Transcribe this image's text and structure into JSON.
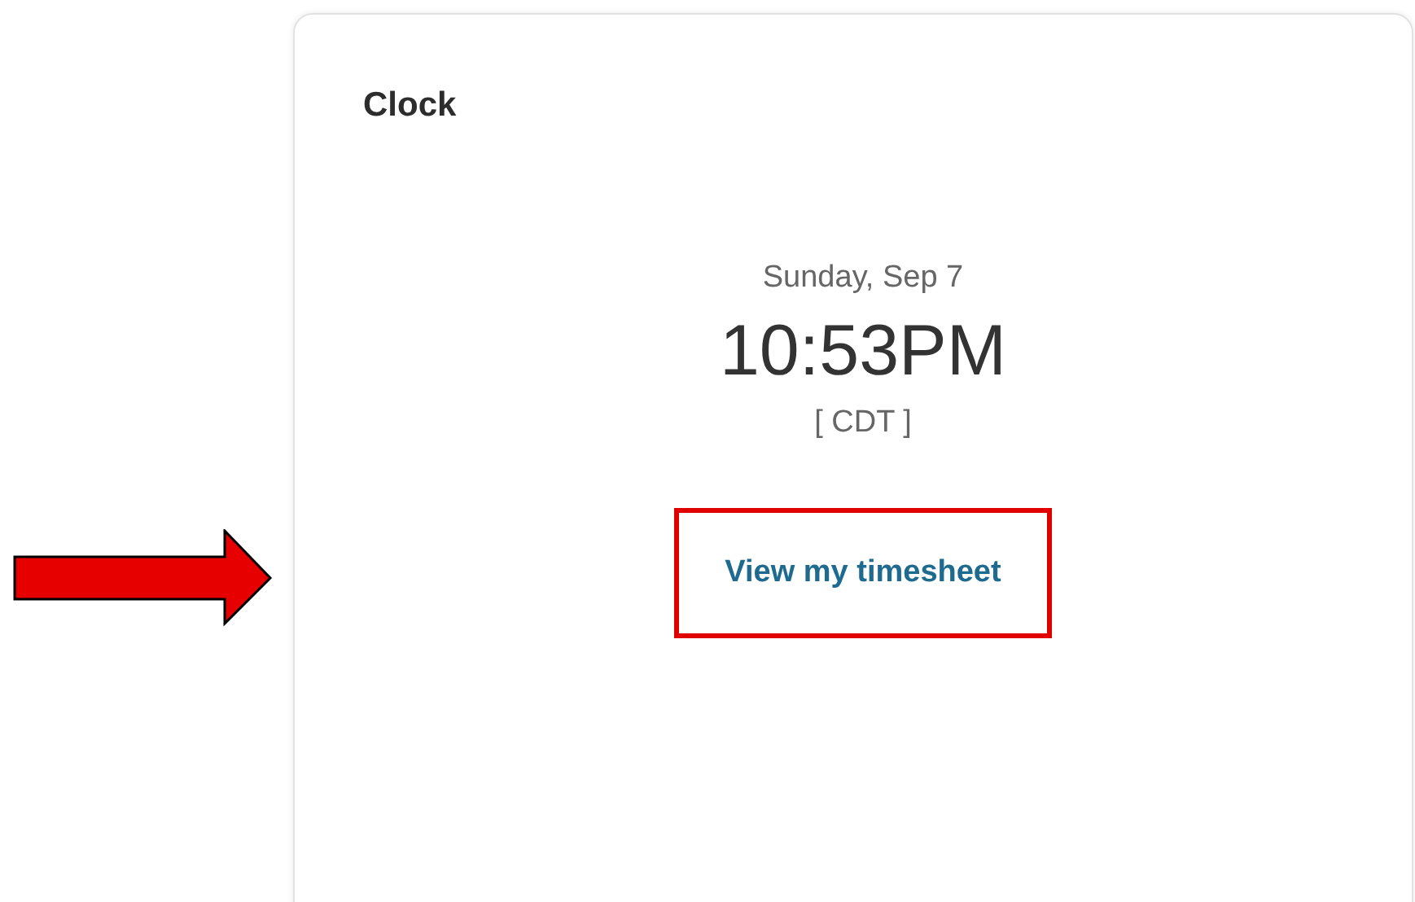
{
  "card": {
    "title": "Clock"
  },
  "clock": {
    "date": "Sunday, Sep 7",
    "time": "10:53PM",
    "timezone": "[ CDT ]"
  },
  "link": {
    "label": "View my timesheet"
  }
}
